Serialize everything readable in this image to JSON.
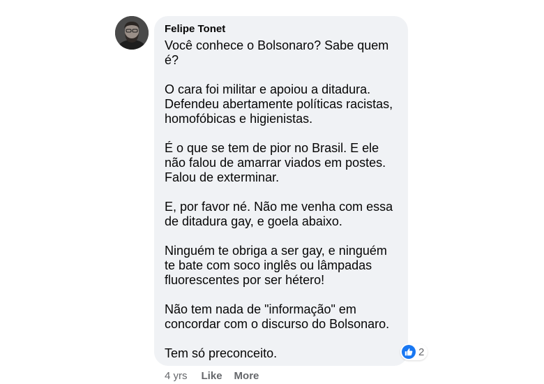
{
  "comment": {
    "author": "Felipe Tonet",
    "paragraphs": [
      "Você conhece o Bolsonaro? Sabe quem é?",
      "O cara foi militar e apoiou a ditadura. Defendeu abertamente políticas racistas, homofóbicas e higienistas.",
      "É o que se tem de pior no Brasil. E ele não falou de amarrar viados em postes. Falou de exterminar.",
      "E, por favor né. Não me venha com essa de ditadura gay, e goela abaixo.",
      "Ninguém te obriga a ser gay, e ninguém te bate com soco inglês ou lâmpadas fluorescentes por ser hétero!",
      "Não tem nada de \"informação\" em concordar com o discurso do Bolsonaro.",
      "Tem só preconceito."
    ],
    "reactions": {
      "icon": "like-icon",
      "count": "2",
      "color": "#1877f2"
    },
    "timestamp": "4 yrs",
    "actions": {
      "like_label": "Like",
      "more_label": "More"
    }
  },
  "colors": {
    "bubble": "#f0f2f5",
    "text": "#050505",
    "muted": "#65676b"
  }
}
